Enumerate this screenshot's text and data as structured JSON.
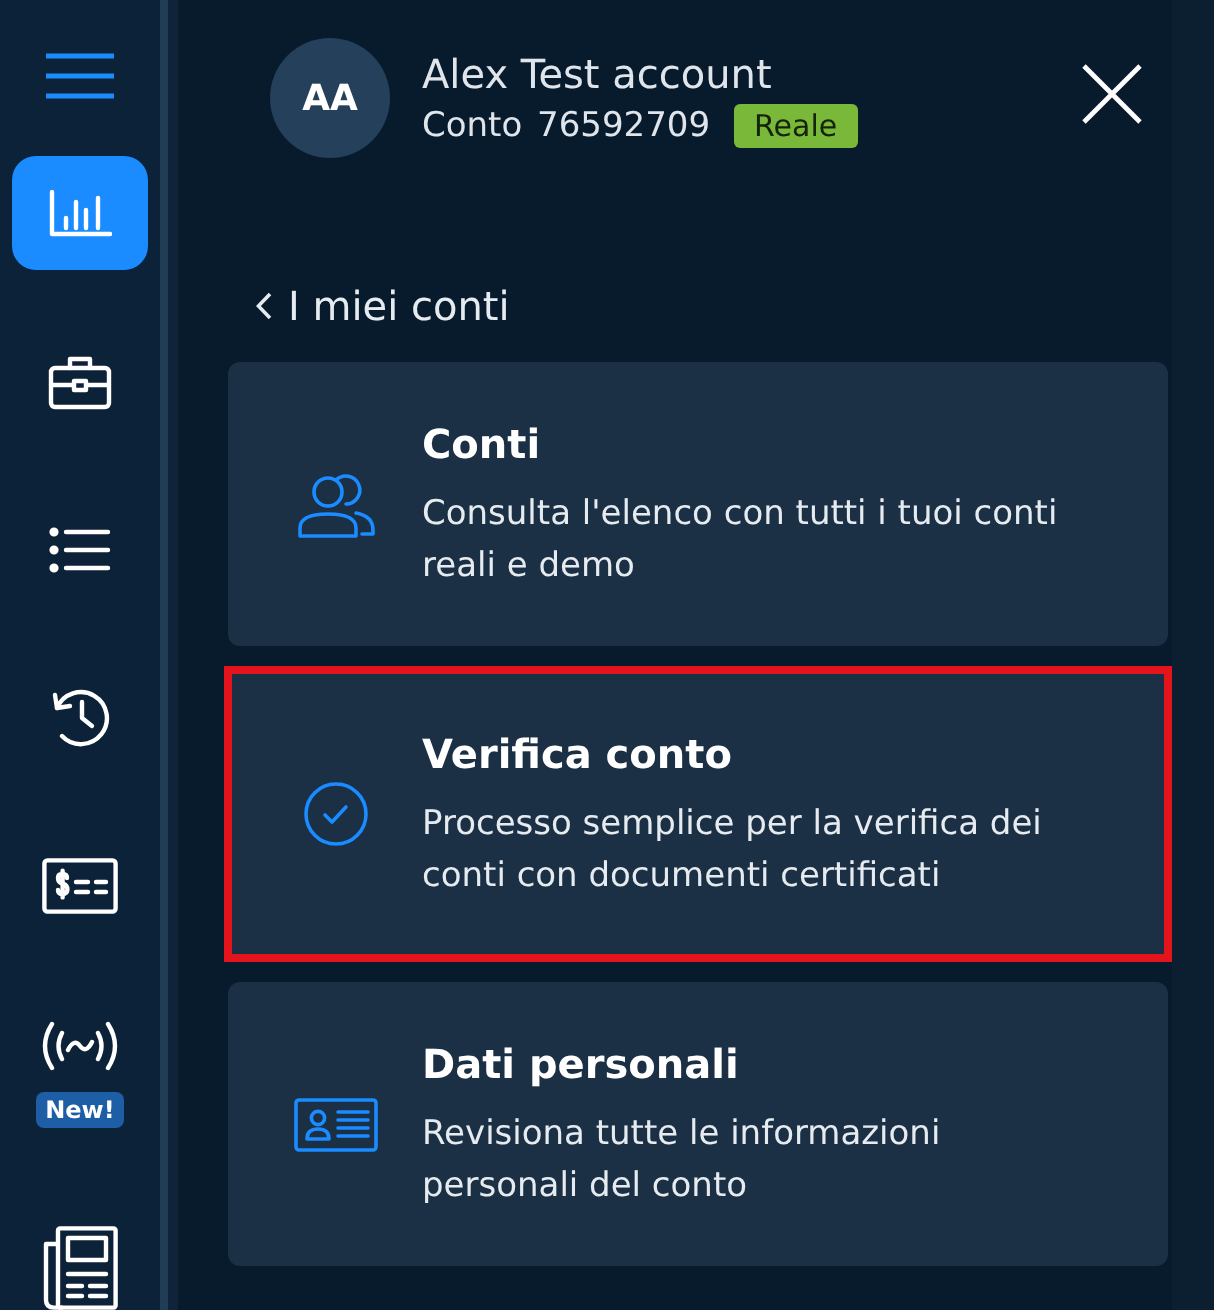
{
  "sidebar": {
    "items": [
      {
        "kind": "chart",
        "selected": true
      },
      {
        "kind": "briefcase",
        "selected": false
      },
      {
        "kind": "list",
        "selected": false
      },
      {
        "kind": "history",
        "selected": false
      },
      {
        "kind": "cheque",
        "selected": false
      },
      {
        "kind": "signal",
        "selected": false,
        "badge": "New!"
      },
      {
        "kind": "newspaper",
        "selected": false
      }
    ]
  },
  "account": {
    "initials": "AA",
    "name": "Alex Test account",
    "number": "Conto 76592709",
    "type_badge": "Reale"
  },
  "back_link": {
    "label": "I miei conti"
  },
  "cards": [
    {
      "kind": "accounts",
      "title": "Conti",
      "description": "Consulta l'elenco con tutti i tuoi conti reali e demo",
      "highlighted": false
    },
    {
      "kind": "verify",
      "title": "Verifica conto",
      "description": "Processo semplice per la verifica dei conti con documenti certificati",
      "highlighted": true
    },
    {
      "kind": "personal",
      "title": "Dati personali",
      "description": "Revisiona tutte le informazioni personali del conto",
      "highlighted": false
    }
  ]
}
